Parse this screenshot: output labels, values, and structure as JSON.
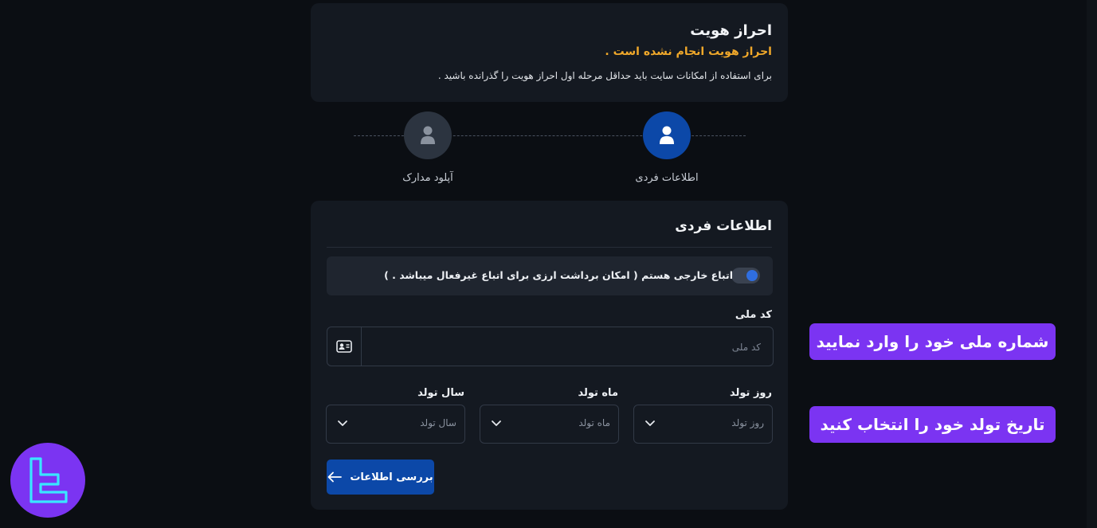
{
  "verification": {
    "title": "احراز هویت",
    "status": "احراز هویت انجام نشده است .",
    "description": "برای استفاده از امکانات سایت باید حداقل مرحله اول احراز هویت را گذرانده باشید ."
  },
  "steps": [
    {
      "label": "اطلاعات فردی",
      "icon": "user-icon",
      "active": true
    },
    {
      "label": "آپلود مدارک",
      "icon": "user-icon",
      "active": false
    }
  ],
  "form": {
    "title": "اطلاعات فردی",
    "foreign_toggle_label": "اتباع خارجی هستم ( امکان برداشت ارزی برای اتباع غیرفعال میباشد . )",
    "foreign_toggle_on": true,
    "national_code": {
      "label": "کد ملی",
      "placeholder": "کد ملی",
      "value": ""
    },
    "birth_day": {
      "label": "روز تولد",
      "placeholder": "روز تولد"
    },
    "birth_month": {
      "label": "ماه تولد",
      "placeholder": "ماه تولد"
    },
    "birth_year": {
      "label": "سال تولد",
      "placeholder": "سال تولد"
    },
    "submit_label": "بررسی اطلاعات"
  },
  "callouts": {
    "national": "شماره ملی خود را وارد نمایید",
    "birthdate": "تاریخ تولد خود را انتخاب کنید"
  },
  "colors": {
    "background": "#0b0e13",
    "card": "#141921",
    "primary": "#0c48a8",
    "warning": "#f0a82a",
    "callout": "#7b34f2"
  }
}
